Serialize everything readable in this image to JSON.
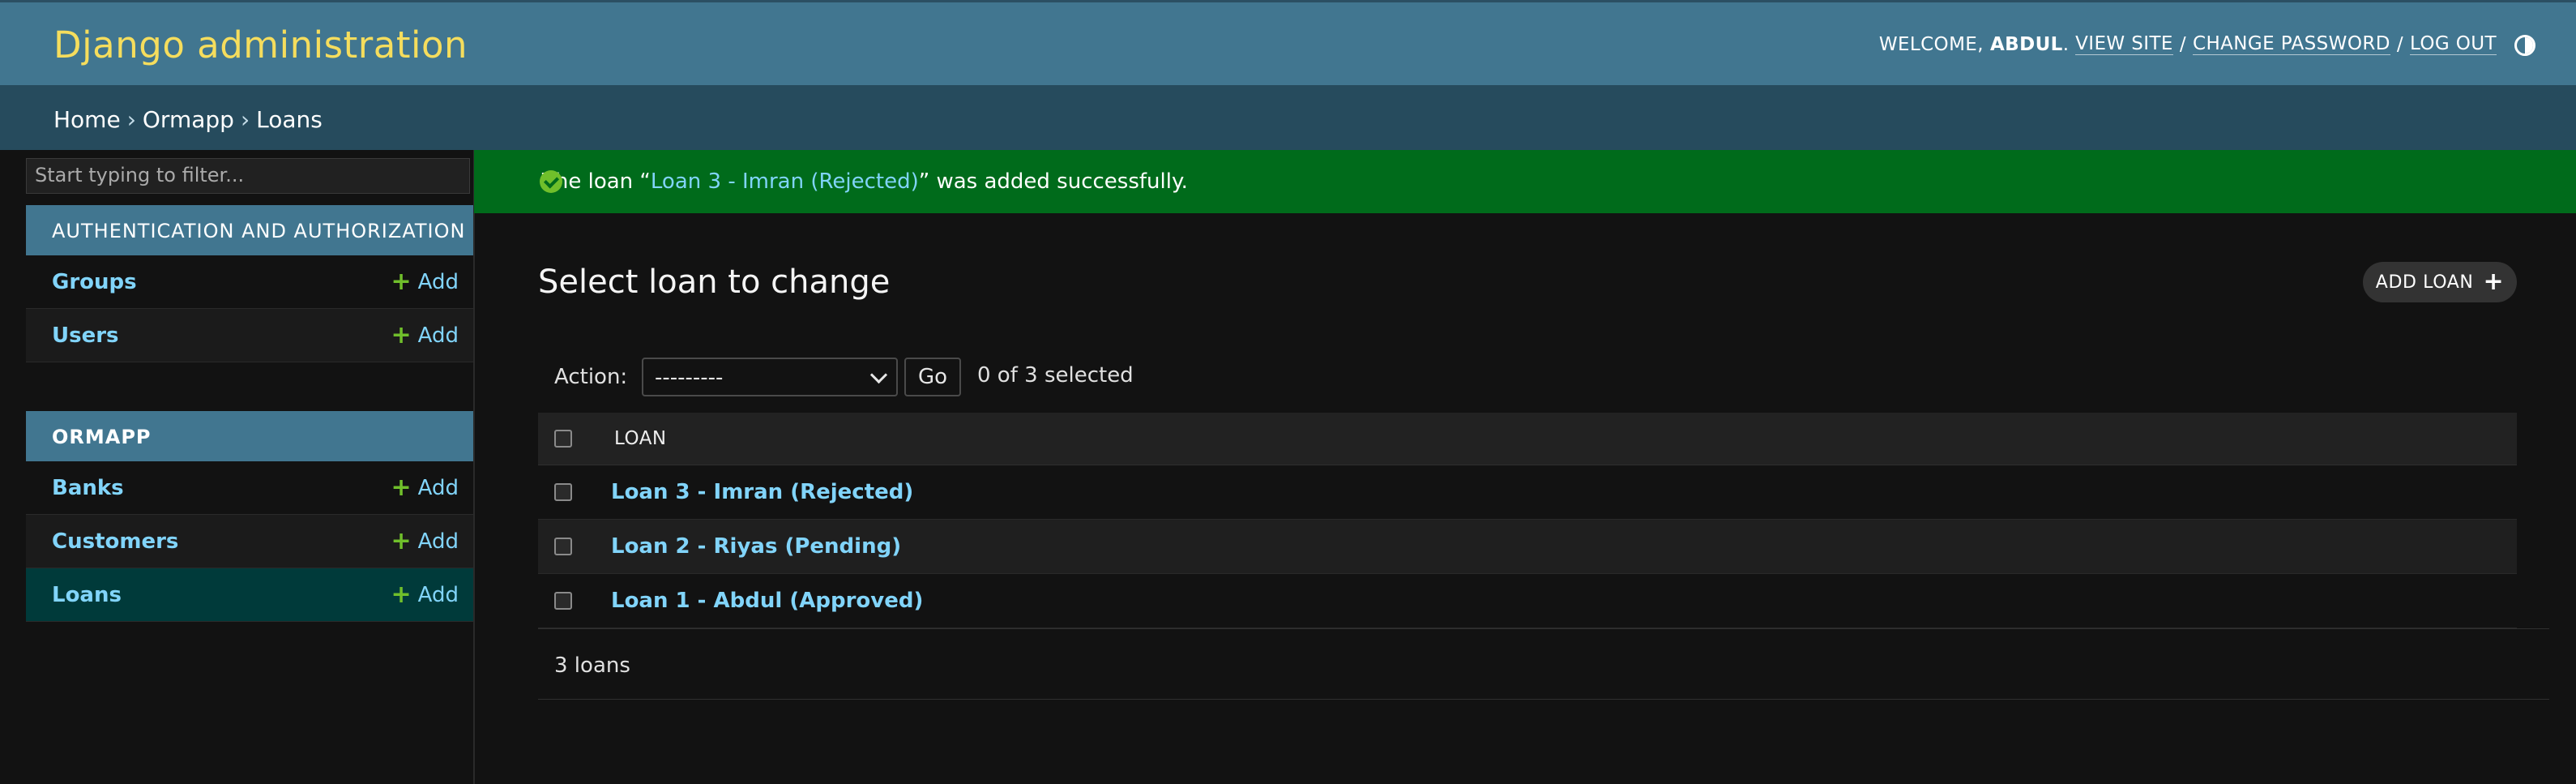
{
  "header": {
    "branding": "Django administration",
    "welcome": "WELCOME,",
    "username": "ABDUL",
    "view_site": "VIEW SITE",
    "change_password": "CHANGE PASSWORD",
    "log_out": "LOG OUT",
    "theme_icon": "theme-toggle-icon"
  },
  "breadcrumbs": [
    "Home",
    "Ormapp",
    "Loans"
  ],
  "sidebar": {
    "filter_placeholder": "Start typing to filter...",
    "modules": [
      {
        "caption": "AUTHENTICATION AND AUTHORIZATION",
        "items": [
          {
            "label": "Groups",
            "add": "Add"
          },
          {
            "label": "Users",
            "add": "Add"
          }
        ]
      },
      {
        "caption": "ORMAPP",
        "items": [
          {
            "label": "Banks",
            "add": "Add"
          },
          {
            "label": "Customers",
            "add": "Add"
          },
          {
            "label": "Loans",
            "add": "Add",
            "selected": true
          }
        ]
      }
    ]
  },
  "message": {
    "prefix": "The loan “",
    "link": "Loan 3 - Imran (Rejected)",
    "suffix": "” was added successfully.",
    "icon": "success-check-icon"
  },
  "main": {
    "title": "Select loan to change",
    "add_button": "ADD LOAN",
    "actions": {
      "label": "Action:",
      "selected_value": "---------",
      "go": "Go",
      "selection_count": "0 of 3 selected"
    },
    "table": {
      "column": "LOAN",
      "rows": [
        "Loan 3 - Imran (Rejected)",
        "Loan 2 - Riyas (Pending)",
        "Loan 1 - Abdul (Approved)"
      ]
    },
    "paginator": "3 loans"
  },
  "colors": {
    "header": "#417690",
    "breadcrumbs": "#264b5d",
    "branding": "#f5dd5d",
    "link": "#81d4fa",
    "success": "#006b1b",
    "add_plus": "#70bf2b"
  }
}
